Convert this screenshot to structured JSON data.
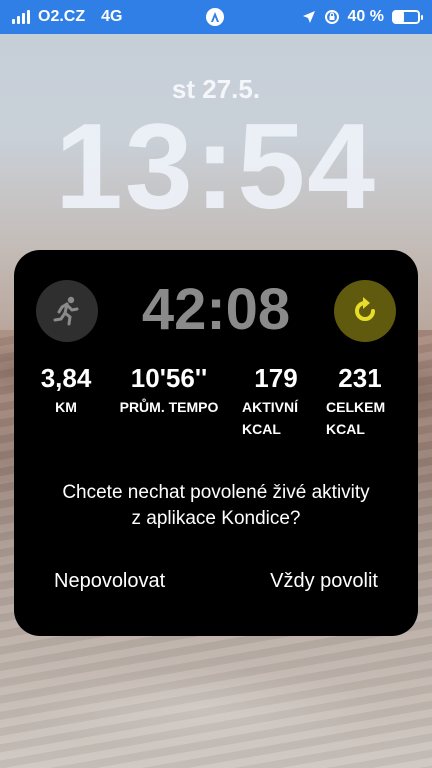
{
  "status_bar": {
    "carrier": "O2.CZ",
    "network": "4G",
    "battery_text": "40 %",
    "battery_level": 0.4,
    "icons": [
      "signal-icon",
      "accessibility-icon",
      "location-icon",
      "rotation-lock-icon",
      "battery-icon"
    ]
  },
  "lock_screen": {
    "date": "st 27.5.",
    "time": "13:54"
  },
  "live_activity": {
    "timer": "42:08",
    "activity_icon": "running-icon",
    "action_icon": "refresh-icon",
    "accent_color": "#e8dc2a",
    "stats": [
      {
        "value": "3,84",
        "label": "KM"
      },
      {
        "value": "10'56''",
        "label": "PRŮM. TEMPO"
      },
      {
        "value": "179",
        "label": "AKTIVNÍ\nKCAL"
      },
      {
        "value": "231",
        "label": "CELKEM\nKCAL"
      }
    ],
    "question": "Chcete nechat povolené živé aktivity\nz aplikace Kondice?",
    "deny_label": "Nepovolovat",
    "allow_label": "Vždy povolit"
  }
}
